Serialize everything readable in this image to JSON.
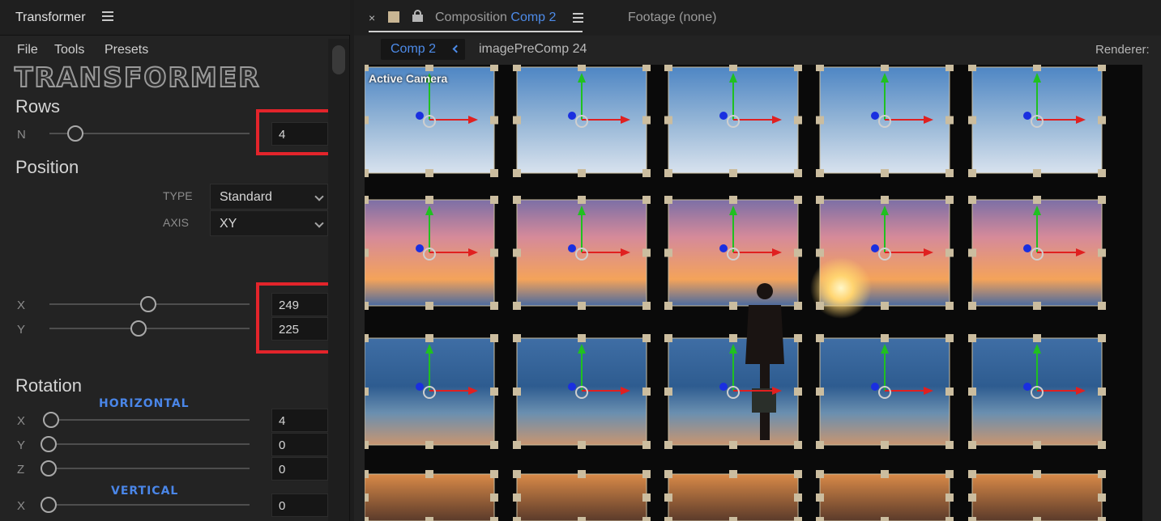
{
  "left_panel": {
    "title": "Transformer",
    "menu": [
      "File",
      "Tools",
      "Presets"
    ],
    "logo": "TRANSFORMER",
    "rows": {
      "heading": "Rows",
      "n_label": "N",
      "n_value": "4"
    },
    "position": {
      "heading": "Position",
      "type_label": "TYPE",
      "type_value": "Standard",
      "axis_label": "AXIS",
      "axis_value": "XY",
      "x_label": "X",
      "x_value": "249",
      "y_label": "Y",
      "y_value": "225"
    },
    "rotation": {
      "heading": "Rotation",
      "horizontal_label": "HORIZONTAL",
      "hx_label": "X",
      "hx_value": "4",
      "hy_label": "Y",
      "hy_value": "0",
      "hz_label": "Z",
      "hz_value": "0",
      "vertical_label": "VERTICAL",
      "vx_label": "X",
      "vx_value": "0"
    }
  },
  "right_panel": {
    "tab_close": "×",
    "tab_composition_prefix": "Composition",
    "tab_composition_name": "Comp 2",
    "tab_footage": "Footage",
    "tab_footage_value": "(none)",
    "comp_chip": "Comp 2",
    "breadcrumb": "imagePreComp 24",
    "renderer_label": "Renderer:",
    "viewer_label": "Active Camera"
  },
  "colors": {
    "accent_blue": "#4d8be8",
    "highlight_red": "#e3242b",
    "axis_x": "#e02020",
    "axis_y": "#20c020",
    "axis_z": "#1a2fe0"
  }
}
